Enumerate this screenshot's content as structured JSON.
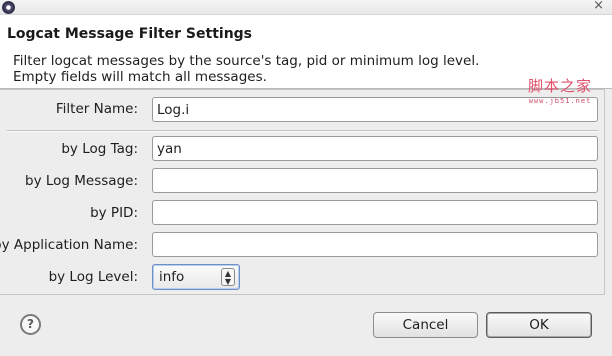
{
  "window": {
    "app_icon": "eclipse-icon",
    "close_glyph": "×"
  },
  "header": {
    "title": "Logcat Message Filter Settings",
    "description_line1": "Filter logcat messages by the source's tag, pid or minimum log level.",
    "description_line2": "Empty fields will match all messages."
  },
  "form": {
    "filter_name": {
      "label": "Filter Name:",
      "value": "Log.i"
    },
    "log_tag": {
      "label": "by Log Tag:",
      "value": "yan"
    },
    "log_message": {
      "label": "by Log Message:",
      "value": ""
    },
    "pid": {
      "label": "by PID:",
      "value": ""
    },
    "app_name": {
      "label": "by Application Name:",
      "value": ""
    },
    "log_level": {
      "label": "by Log Level:",
      "value": "info",
      "arrows": "⌃⌄"
    }
  },
  "footer": {
    "help_glyph": "?",
    "cancel_label": "Cancel",
    "ok_label": "OK"
  },
  "watermark": {
    "text_cn": "脚本之家",
    "text_url": "www.jb51.net"
  }
}
